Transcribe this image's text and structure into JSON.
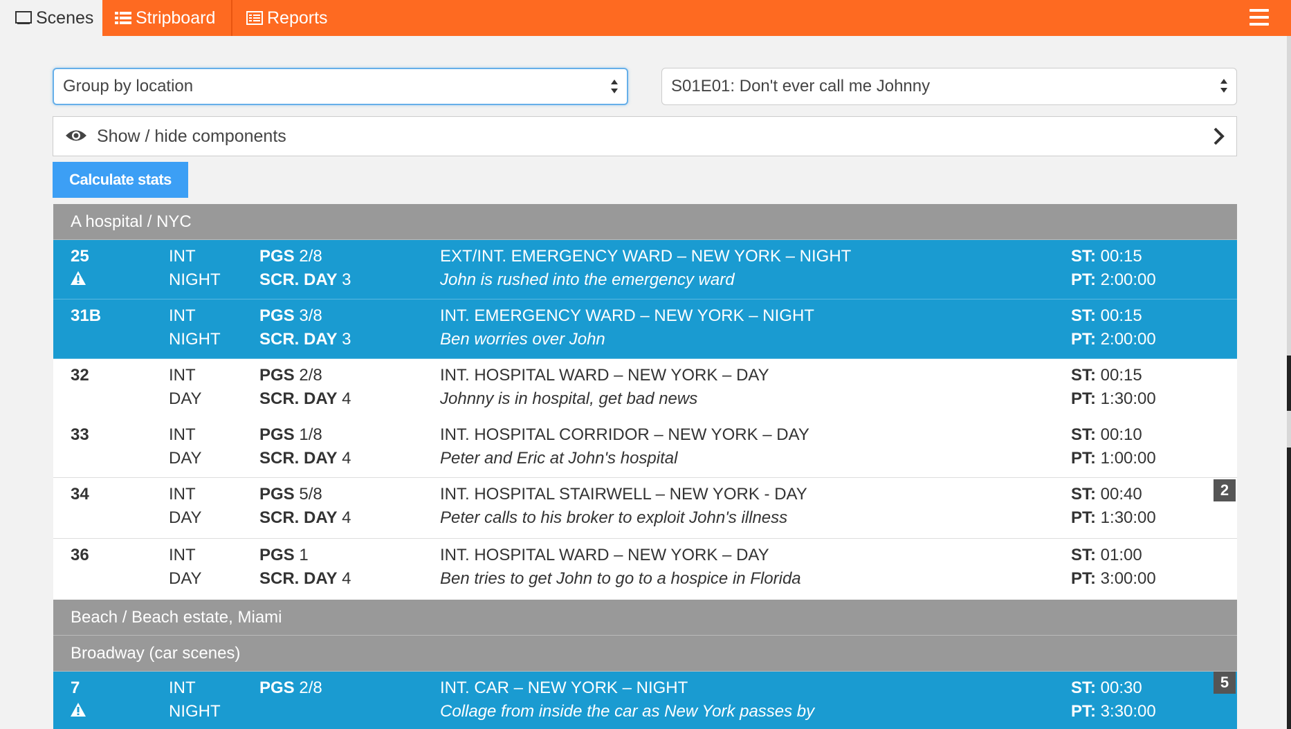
{
  "nav": {
    "tabs": [
      {
        "label": "Scenes",
        "icon": "film-icon",
        "active": true
      },
      {
        "label": "Stripboard",
        "icon": "list-icon",
        "active": false
      },
      {
        "label": "Reports",
        "icon": "report-icon",
        "active": false
      }
    ],
    "menu_icon": "hamburger-icon"
  },
  "controls": {
    "group_select": "Group by location",
    "episode_select": "S01E01: Don't ever call me Johnny",
    "show_hide_label": "Show / hide components",
    "calculate_label": "Calculate stats"
  },
  "labels": {
    "pgs": "PGS",
    "scr_day": "SCR. DAY",
    "st": "ST:",
    "pt": "PT:"
  },
  "colors": {
    "accent_orange": "#fe6a21",
    "selected_blue": "#1a9bd1",
    "button_blue": "#3c9ff5",
    "group_gray": "#999999"
  },
  "groups": [
    {
      "name": "A hospital / NYC",
      "scenes": [
        {
          "number": "25",
          "warning": true,
          "ie": "INT",
          "time": "NIGHT",
          "pages": "2/8",
          "scr_day": "3",
          "heading": "EXT/INT. EMERGENCY WARD – NEW YORK – NIGHT",
          "summary": "John is rushed into the emergency ward",
          "st": "00:15",
          "pt": "2:00:00",
          "selected": true
        },
        {
          "number": "31B",
          "warning": false,
          "ie": "INT",
          "time": "NIGHT",
          "pages": "3/8",
          "scr_day": "3",
          "heading": "INT. EMERGENCY WARD – NEW YORK – NIGHT",
          "summary": "Ben worries over John",
          "st": "00:15",
          "pt": "2:00:00",
          "selected": true
        },
        {
          "number": "32",
          "warning": false,
          "ie": "INT",
          "time": "DAY",
          "pages": "2/8",
          "scr_day": "4",
          "heading": "INT. HOSPITAL WARD – NEW YORK – DAY",
          "summary": "Johnny is in hospital, get bad news",
          "st": "00:15",
          "pt": "1:30:00",
          "selected": false
        },
        {
          "number": "33",
          "warning": false,
          "ie": "INT",
          "time": "DAY",
          "pages": "1/8",
          "scr_day": "4",
          "heading": "INT. HOSPITAL CORRIDOR – NEW YORK – DAY",
          "summary": "Peter and Eric at John's hospital",
          "st": "00:10",
          "pt": "1:00:00",
          "selected": false
        },
        {
          "number": "34",
          "warning": false,
          "ie": "INT",
          "time": "DAY",
          "pages": "5/8",
          "scr_day": "4",
          "heading": "INT. HOSPITAL STAIRWELL – NEW YORK - DAY",
          "summary": "Peter calls to his broker to exploit John's illness",
          "st": "00:40",
          "pt": "1:30:00",
          "selected": false,
          "badge": "2"
        },
        {
          "number": "36",
          "warning": false,
          "ie": "INT",
          "time": "DAY",
          "pages": "1",
          "scr_day": "4",
          "heading": "INT. HOSPITAL WARD – NEW YORK – DAY",
          "summary": "Ben tries to get John to go to a hospice in Florida",
          "st": "01:00",
          "pt": "3:00:00",
          "selected": false
        }
      ]
    },
    {
      "name": "Beach / Beach estate, Miami",
      "scenes": []
    },
    {
      "name": "Broadway (car scenes)",
      "scenes": [
        {
          "number": "7",
          "warning": true,
          "ie": "INT",
          "time": "NIGHT",
          "pages": "2/8",
          "heading": "INT. CAR – NEW YORK – NIGHT",
          "summary": "Collage from inside the car as New York passes by",
          "st": "00:30",
          "pt": "3:30:00",
          "selected": true,
          "badge": "5"
        }
      ]
    }
  ]
}
